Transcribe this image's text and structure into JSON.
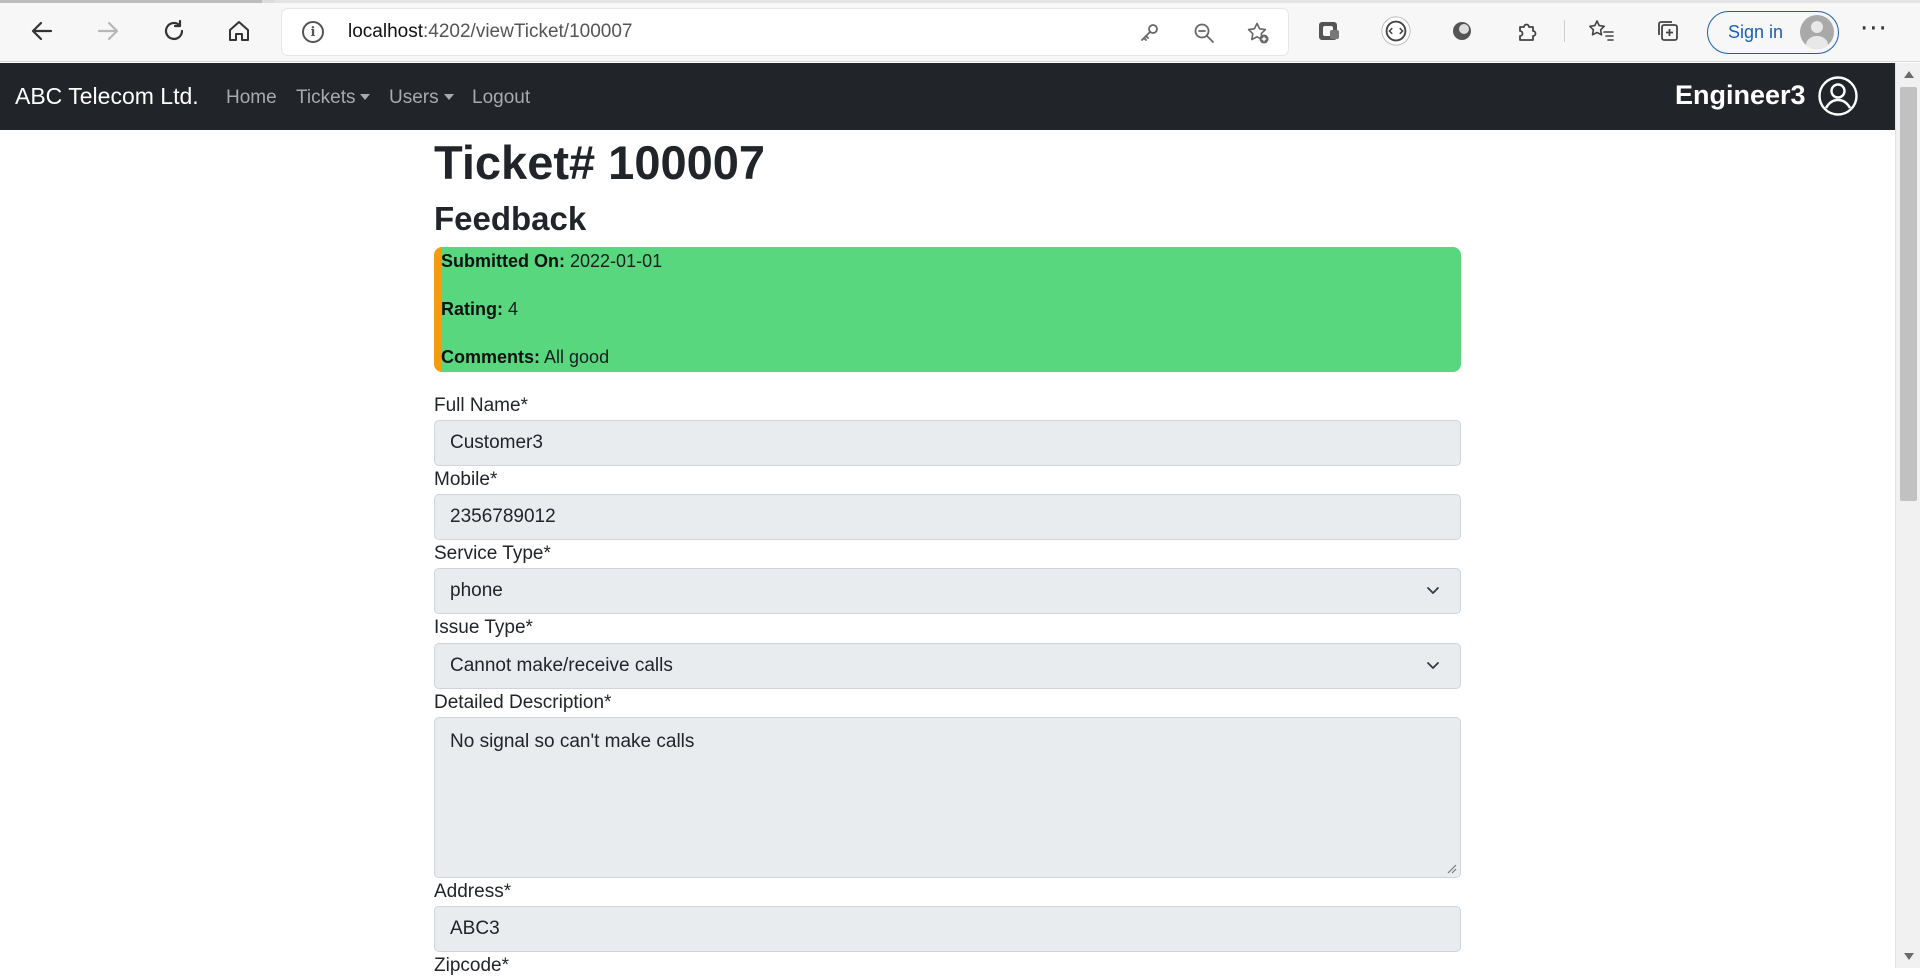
{
  "browser": {
    "url_host": "localhost",
    "url_path": ":4202/viewTicket/100007",
    "signin_label": "Sign in"
  },
  "navbar": {
    "brand": "ABC Telecom Ltd.",
    "links": {
      "home": "Home",
      "tickets": "Tickets",
      "users": "Users",
      "logout": "Logout"
    },
    "user_name": "Engineer3"
  },
  "ticket": {
    "title": "Ticket# 100007",
    "feedback_heading": "Feedback",
    "feedback": {
      "submitted_label": "Submitted On:",
      "submitted_value": "2022-01-01",
      "rating_label": "Rating:",
      "rating_value": "4",
      "comments_label": "Comments:",
      "comments_value": "All good"
    }
  },
  "form": {
    "full_name_label": "Full Name*",
    "full_name_value": "Customer3",
    "mobile_label": "Mobile*",
    "mobile_value": "2356789012",
    "service_type_label": "Service Type*",
    "service_type_value": "phone",
    "issue_type_label": "Issue Type*",
    "issue_type_value": "Cannot make/receive calls",
    "description_label": "Detailed Description*",
    "description_value": "No signal so can't make calls",
    "address_label": "Address*",
    "address_value": "ABC3",
    "zipcode_label": "Zipcode*"
  },
  "colors": {
    "navbar_bg": "#212529",
    "feedback_bg": "#58d77e",
    "feedback_accent": "#f39c12",
    "field_bg": "#e9ecef",
    "signin_blue": "#1a5fb4"
  },
  "icons": {
    "back": "back-arrow-icon",
    "forward": "forward-arrow-icon",
    "refresh": "refresh-icon",
    "home": "home-icon",
    "info": "info-icon",
    "key": "key-icon",
    "zoom": "zoom-out-icon",
    "favorite_add": "add-favorite-icon",
    "user": "user-circle-icon"
  }
}
